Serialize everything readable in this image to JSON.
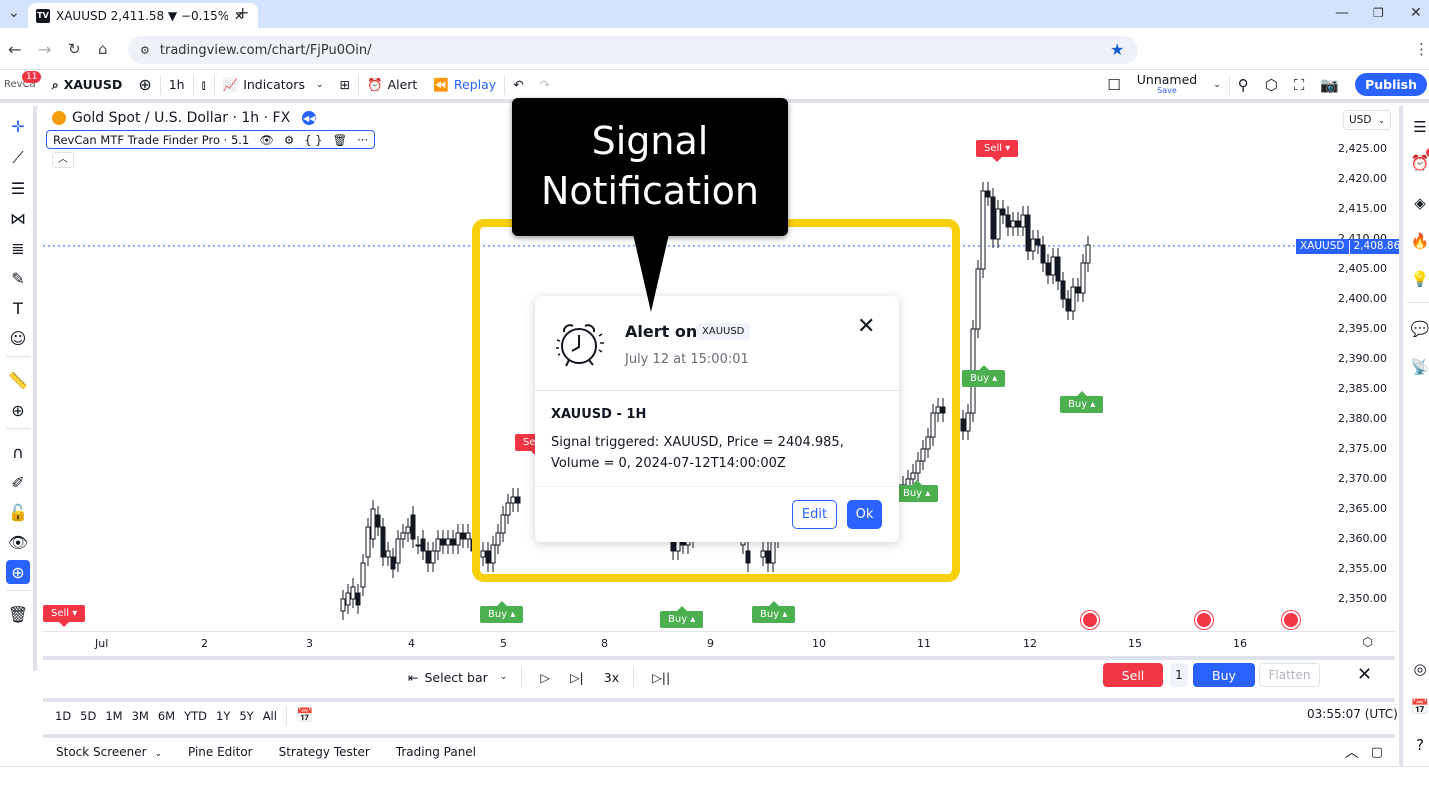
{
  "browser": {
    "tab_title": "XAUUSD 2,411.58 ▼ −0.15% Unnamed",
    "tab_favicon": "TV",
    "url": "tradingview.com/chart/FjPu0Oin/"
  },
  "toolbar": {
    "profile_label": "RevCa",
    "notification_count": "11",
    "symbol": "XAUUSD",
    "interval": "1h",
    "indicators_label": "Indicators",
    "alert_label": "Alert",
    "replay_label": "Replay",
    "layout_name": "Unnamed",
    "save_label": "Save",
    "publish_label": "Publish"
  },
  "chart": {
    "title": "Gold Spot / U.S. Dollar · 1h · FX",
    "indicator_name": "RevCan MTF Trade Finder Pro · 5.1",
    "currency": "USD",
    "price_tag_symbol": "XAUUSD",
    "price_tag_value": "2,408.86",
    "y_ticks": [
      "2,425.00",
      "2,420.00",
      "2,415.00",
      "2,410.00",
      "2,405.00",
      "2,400.00",
      "2,395.00",
      "2,390.00",
      "2,385.00",
      "2,380.00",
      "2,375.00",
      "2,370.00",
      "2,365.00",
      "2,360.00",
      "2,355.00",
      "2,350.00"
    ],
    "x_ticks": [
      "Jul",
      "2",
      "3",
      "4",
      "5",
      "8",
      "9",
      "10",
      "11",
      "12",
      "15",
      "16"
    ],
    "signals": [
      {
        "type": "sell",
        "label": "Sell ▾"
      },
      {
        "type": "sell",
        "label": "Sell ▾"
      },
      {
        "type": "sell",
        "label": "Sell ▾"
      },
      {
        "type": "buy",
        "label": "Buy ▴"
      },
      {
        "type": "buy",
        "label": "Buy ▴"
      },
      {
        "type": "buy",
        "label": "Buy ▴"
      },
      {
        "type": "buy",
        "label": "Buy ▴"
      },
      {
        "type": "buy",
        "label": "Buy ▴"
      },
      {
        "type": "buy",
        "label": "Buy ▴"
      }
    ]
  },
  "annotation": {
    "callout_line1": "Signal",
    "callout_line2": "Notification"
  },
  "alert_dialog": {
    "title": "Alert on",
    "symbol_badge": "XAUUSD",
    "timestamp": "July 12 at 15:00:01",
    "heading": "XAUUSD - 1H",
    "message": "Signal triggered: XAUUSD, Price = 2404.985, Volume = 0, 2024-07-12T14:00:00Z",
    "edit_label": "Edit",
    "ok_label": "Ok"
  },
  "replay": {
    "select_bar_label": "Select bar",
    "speed": "3x",
    "sell_label": "Sell",
    "quantity": "1",
    "buy_label": "Buy",
    "flatten_label": "Flatten"
  },
  "range": {
    "buttons": [
      "1D",
      "5D",
      "1M",
      "3M",
      "6M",
      "YTD",
      "1Y",
      "5Y",
      "All"
    ],
    "clock": "03:55:07 (UTC)"
  },
  "bottom_tabs": [
    "Stock Screener",
    "Pine Editor",
    "Strategy Tester",
    "Trading Panel"
  ],
  "right_sidebar": {
    "alerts_badge": "1"
  }
}
